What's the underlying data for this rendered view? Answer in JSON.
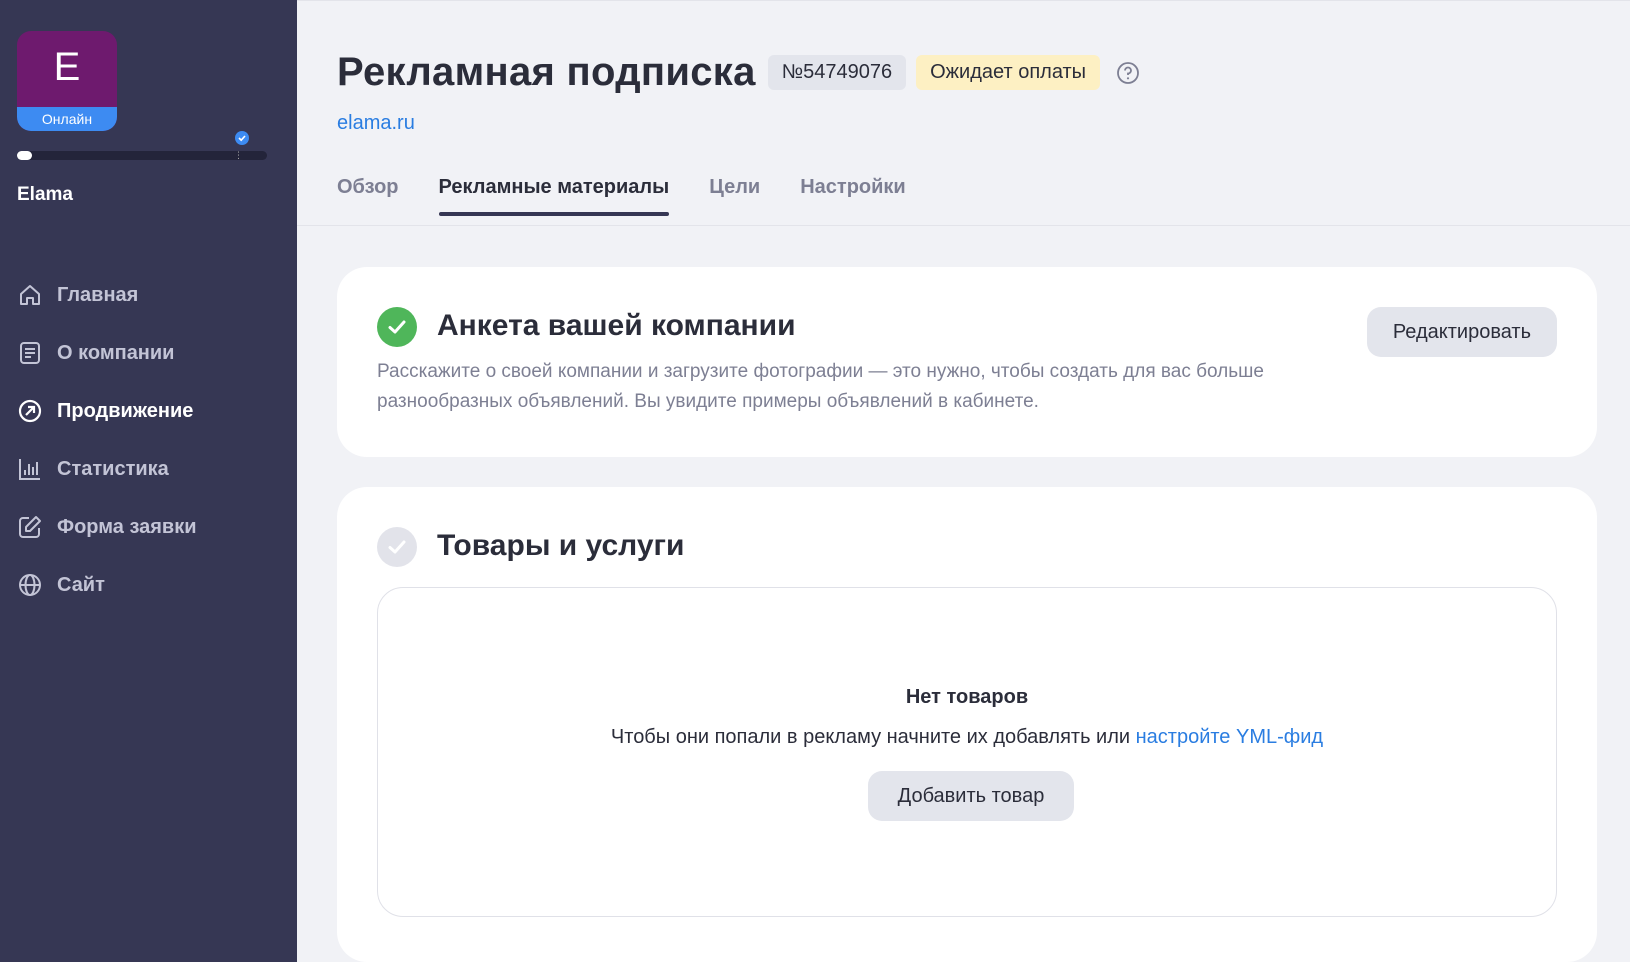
{
  "sidebar": {
    "avatar_letter": "E",
    "avatar_status": "Онлайн",
    "progress_fraction": 0.06,
    "company_name": "Elama",
    "items": [
      {
        "label": "Главная",
        "icon": "home-icon",
        "active": false
      },
      {
        "label": "О компании",
        "icon": "document-icon",
        "active": false
      },
      {
        "label": "Продвижение",
        "icon": "promotion-arrow-icon",
        "active": true
      },
      {
        "label": "Статистика",
        "icon": "bar-chart-icon",
        "active": false
      },
      {
        "label": "Форма заявки",
        "icon": "edit-form-icon",
        "active": false
      },
      {
        "label": "Сайт",
        "icon": "globe-icon",
        "active": false
      }
    ]
  },
  "header": {
    "title": "Рекламная подписка",
    "number": "№54749076",
    "status": "Ожидает оплаты",
    "site": "elama.ru"
  },
  "tabs": [
    {
      "label": "Обзор",
      "active": false
    },
    {
      "label": "Рекламные материалы",
      "active": true
    },
    {
      "label": "Цели",
      "active": false
    },
    {
      "label": "Настройки",
      "active": false
    }
  ],
  "company_card": {
    "title": "Анкета вашей компании",
    "description": "Расскажите о своей компании и загрузите фотографии — это нужно, чтобы создать для вас больше разнообразных объявлений. Вы увидите примеры объявлений в кабинете.",
    "edit_label": "Редактировать",
    "completed": true
  },
  "products_card": {
    "title": "Товары и услуги",
    "completed": false,
    "empty_title": "Нет товаров",
    "empty_text": "Чтобы они попали в рекламу начните их добавлять или",
    "empty_link": "настройте YML-фид",
    "add_label": "Добавить товар"
  },
  "colors": {
    "sidebar_bg": "#363754",
    "accent_blue": "#2a7de1",
    "success_green": "#4fb65a",
    "status_yellow": "#fdf0c3",
    "avatar_purple": "#6e1a6e"
  }
}
